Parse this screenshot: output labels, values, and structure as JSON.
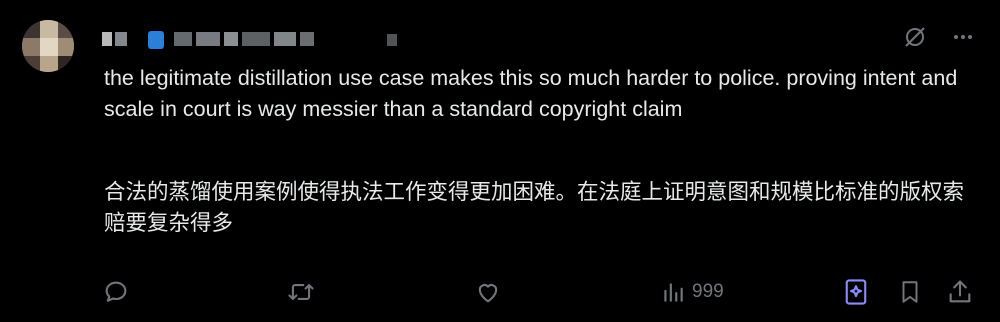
{
  "post": {
    "text_en": "the legitimate distillation use case makes this so much harder to police. proving intent and scale in court is way messier than a standard copyright claim",
    "text_zh": "合法的蒸馏使用案例使得执法工作变得更加困难。在法庭上证明意图和规模比标准的版权索赔要复杂得多"
  },
  "stats": {
    "views": "999"
  },
  "colors": {
    "background": "#000000",
    "text": "#e7e9ea",
    "icon_gray": "#71767b",
    "grok_accent": "#8b8cff",
    "verified_blue": "#2a7fd9"
  },
  "icons": {
    "top": [
      "grok-slash-icon",
      "more-icon"
    ],
    "actions": [
      "reply-icon",
      "repost-icon",
      "like-icon",
      "views-icon",
      "grok-icon",
      "bookmark-icon",
      "share-icon"
    ]
  }
}
